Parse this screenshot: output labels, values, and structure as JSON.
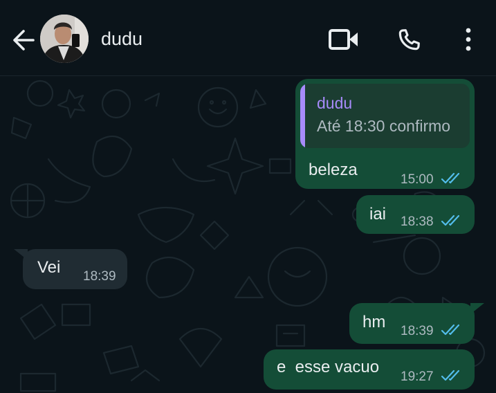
{
  "header": {
    "contact_name": "dudu",
    "back_icon": "arrow-left-icon",
    "video_icon": "video-call-icon",
    "call_icon": "phone-icon",
    "menu_icon": "more-vert-icon"
  },
  "colors": {
    "background": "#0b141a",
    "outgoing_bubble": "#144d37",
    "incoming_bubble": "#202c33",
    "quote_accent": "#a78bfa",
    "read_ticks": "#53bdeb"
  },
  "messages": [
    {
      "direction": "outgoing",
      "reply_to": {
        "author": "dudu",
        "text": "Até 18:30 confirmo"
      },
      "text": "beleza",
      "time": "15:00",
      "status": "read"
    },
    {
      "direction": "outgoing",
      "text": "iai",
      "time": "18:38",
      "status": "read"
    },
    {
      "direction": "incoming",
      "text": "Vei",
      "time": "18:39"
    },
    {
      "direction": "outgoing",
      "text": "hm",
      "time": "18:39",
      "status": "read"
    },
    {
      "direction": "outgoing",
      "text": "e  esse vacuo",
      "time": "19:27",
      "status": "read"
    }
  ]
}
